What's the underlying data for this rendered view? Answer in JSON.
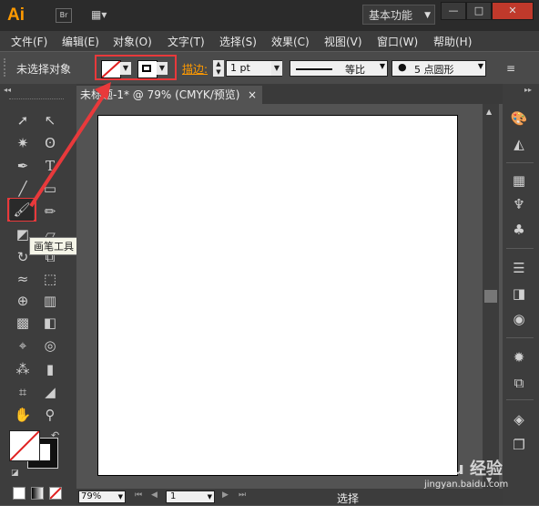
{
  "app": {
    "logo": "Ai",
    "bridge_label": "Br",
    "workspace": "基本功能"
  },
  "menu": [
    "文件(F)",
    "编辑(E)",
    "对象(O)",
    "文字(T)",
    "选择(S)",
    "效果(C)",
    "视图(V)",
    "窗口(W)",
    "帮助(H)"
  ],
  "control": {
    "selection": "未选择对象",
    "stroke_label": "描边:",
    "stroke_weight": "1 pt",
    "profile": "等比",
    "brush": "5 点圆形"
  },
  "document": {
    "tab_title": "未标题-1* @ 79% (CMYK/预览)",
    "tab_close": "×"
  },
  "tooltip": "画笔工具 (B)",
  "status": {
    "zoom": "79%",
    "page": "1",
    "mode": "选择"
  },
  "watermark": "jingyan.baidu.com",
  "colors": {
    "highlight": "#e8393b",
    "ai_orange": "#ff9a00"
  }
}
